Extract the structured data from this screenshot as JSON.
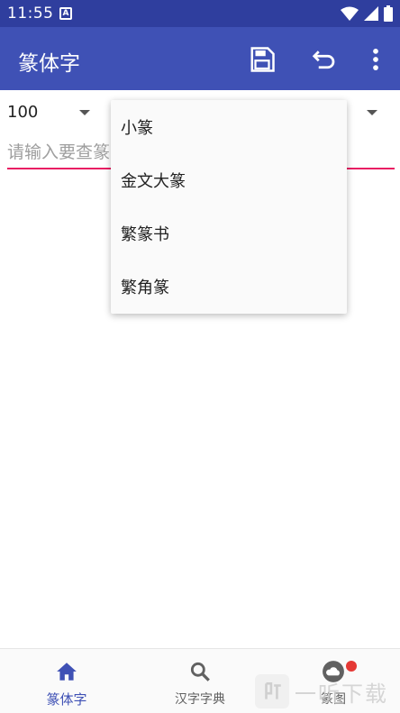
{
  "status_bar": {
    "time": "11:55",
    "indicator": "A"
  },
  "app_bar": {
    "title": "篆体字",
    "actions": [
      "save-icon",
      "undo-icon",
      "more-vert-icon"
    ]
  },
  "font_size_spinner": {
    "value": "100"
  },
  "search": {
    "placeholder": "请输入要查篆"
  },
  "dropdown_menu": {
    "items": [
      "小篆",
      "金文大篆",
      "繁篆书",
      "繁角篆"
    ]
  },
  "bottom_nav": {
    "tabs": [
      {
        "label": "篆体字",
        "icon": "home-icon",
        "active": true
      },
      {
        "label": "汉字字典",
        "icon": "search-icon",
        "active": false
      },
      {
        "label": "篆图",
        "icon": "cloud-icon",
        "active": false,
        "badge": true
      }
    ]
  },
  "watermark": {
    "text": "一听下载"
  },
  "colors": {
    "primary": "#3f51b5",
    "primary_dark": "#2f3e9e",
    "accent": "#e91e63",
    "badge": "#e53935"
  }
}
